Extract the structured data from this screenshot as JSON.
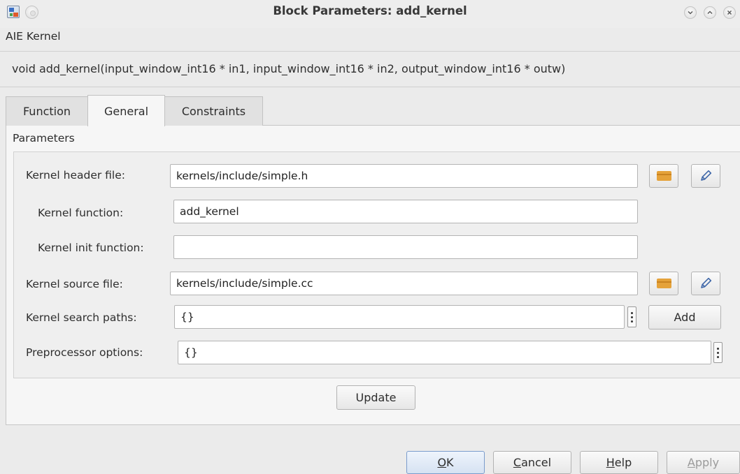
{
  "window": {
    "title": "Block Parameters: add_kernel"
  },
  "block_type": "AIE Kernel",
  "signature": "void add_kernel(input_window_int16 * in1, input_window_int16 * in2, output_window_int16 * outw)",
  "tabs": [
    {
      "label": "Function",
      "active": false
    },
    {
      "label": "General",
      "active": true
    },
    {
      "label": "Constraints",
      "active": false
    }
  ],
  "parameters": {
    "group_label": "Parameters",
    "kernel_header_file": {
      "label": "Kernel header file:",
      "value": "kernels/include/simple.h"
    },
    "kernel_function": {
      "label": "Kernel function:",
      "value": "add_kernel"
    },
    "kernel_init_function": {
      "label": "Kernel init function:",
      "value": ""
    },
    "kernel_source_file": {
      "label": "Kernel source file:",
      "value": "kernels/include/simple.cc"
    },
    "kernel_search_paths": {
      "label": "Kernel search paths:",
      "value": "{}"
    },
    "preprocessor_options": {
      "label": "Preprocessor options:",
      "value": "{}"
    },
    "add_label": "Add",
    "update_label": "Update"
  },
  "footer": {
    "ok": {
      "mnemonic": "O",
      "rest": "K"
    },
    "cancel": {
      "mnemonic": "C",
      "rest": "ancel"
    },
    "help": {
      "mnemonic": "H",
      "rest": "elp"
    },
    "apply": {
      "mnemonic": "A",
      "rest": "pply",
      "disabled": true
    }
  },
  "icons": {
    "browse": "folder-icon",
    "edit": "pencil-icon",
    "more": "vertical-ellipsis-icon"
  },
  "colors": {
    "folder": "#e5a23a",
    "pencil": "#3f67a8",
    "primary_button_border": "#7a9ccc"
  }
}
